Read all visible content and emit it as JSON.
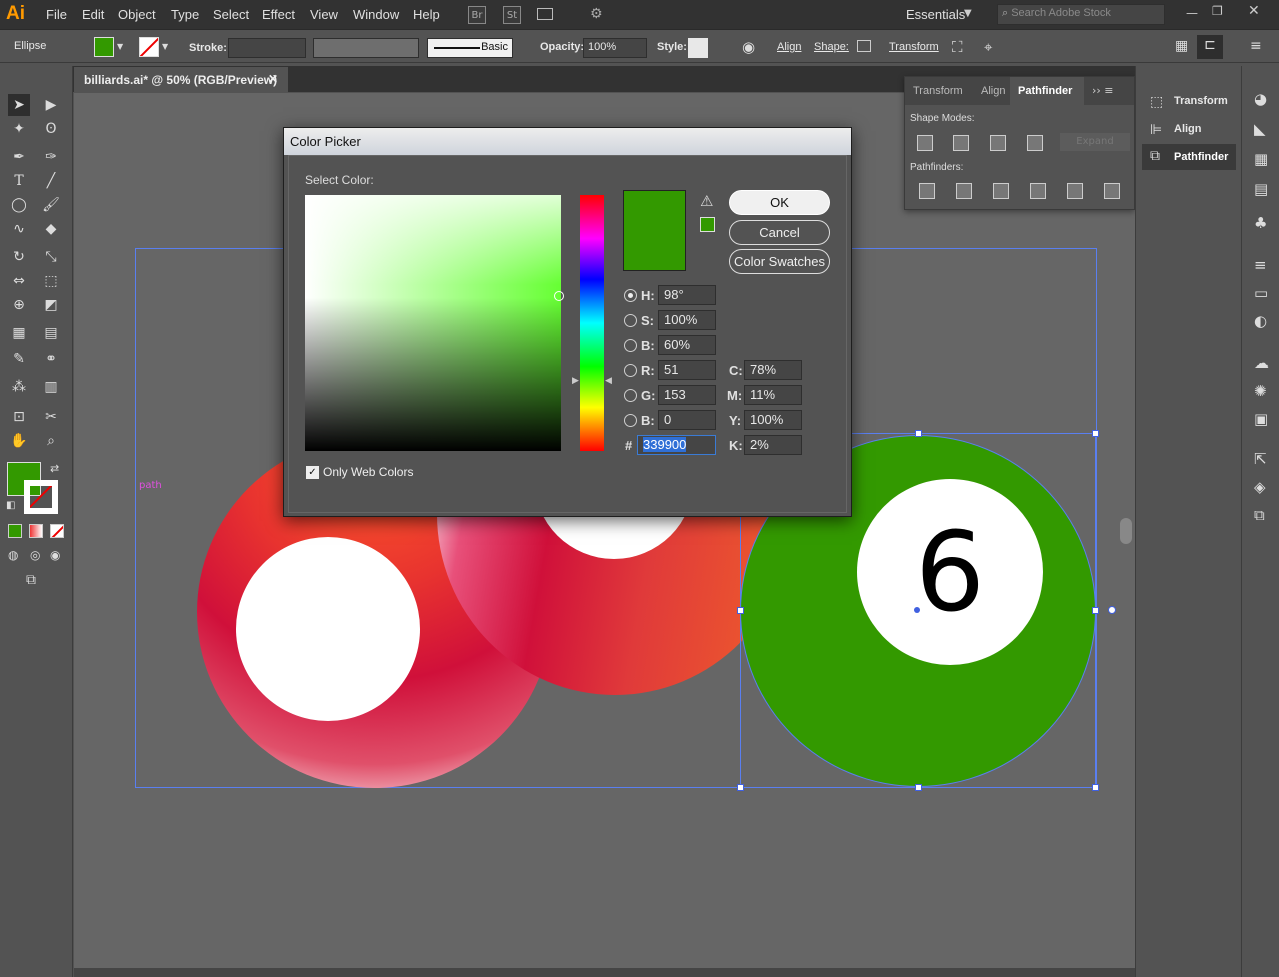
{
  "app": {
    "logo": "Ai",
    "workspace": "Essentials",
    "search_placeholder": "Search Adobe Stock"
  },
  "menu": [
    "File",
    "Edit",
    "Object",
    "Type",
    "Select",
    "Effect",
    "View",
    "Window",
    "Help"
  ],
  "menu_icons": {
    "br": "Br",
    "st": "St"
  },
  "control": {
    "selection_type": "Ellipse",
    "stroke_label": "Stroke:",
    "brush_label": "Basic",
    "opacity_label": "Opacity:",
    "opacity_value": "100%",
    "style_label": "Style:",
    "align": "Align",
    "shape": "Shape:",
    "transform": "Transform"
  },
  "document": {
    "tab_title": "billiards.ai* @ 50% (RGB/Preview)"
  },
  "canvas": {
    "smart_guide": "path",
    "ball_number": "6"
  },
  "pathfinder_panel": {
    "tabs": [
      "Transform",
      "Align",
      "Pathfinder"
    ],
    "shape_modes_label": "Shape Modes:",
    "expand_label": "Expand",
    "pathfinders_label": "Pathfinders:"
  },
  "dock": {
    "items": [
      "Transform",
      "Align",
      "Pathfinder"
    ]
  },
  "color_picker": {
    "title": "Color Picker",
    "select_color_label": "Select Color:",
    "ok": "OK",
    "cancel": "Cancel",
    "swatches": "Color Swatches",
    "fields": {
      "h_label": "H:",
      "h": "98°",
      "s_label": "S:",
      "s": "100%",
      "b_label": "B:",
      "b": "60%",
      "r_label": "R:",
      "r": "51",
      "g_label": "G:",
      "g": "153",
      "b2_label": "B:",
      "b2": "0",
      "hex_label": "#",
      "hex": "339900",
      "c_label": "C:",
      "c": "78%",
      "m_label": "M:",
      "m": "11%",
      "y_label": "Y:",
      "y": "100%",
      "k_label": "K:",
      "k": "2%"
    },
    "only_web_colors": "Only Web Colors",
    "current_color": "#339900"
  },
  "colors": {
    "fill": "#339900",
    "accent": "#2f9c0a"
  }
}
